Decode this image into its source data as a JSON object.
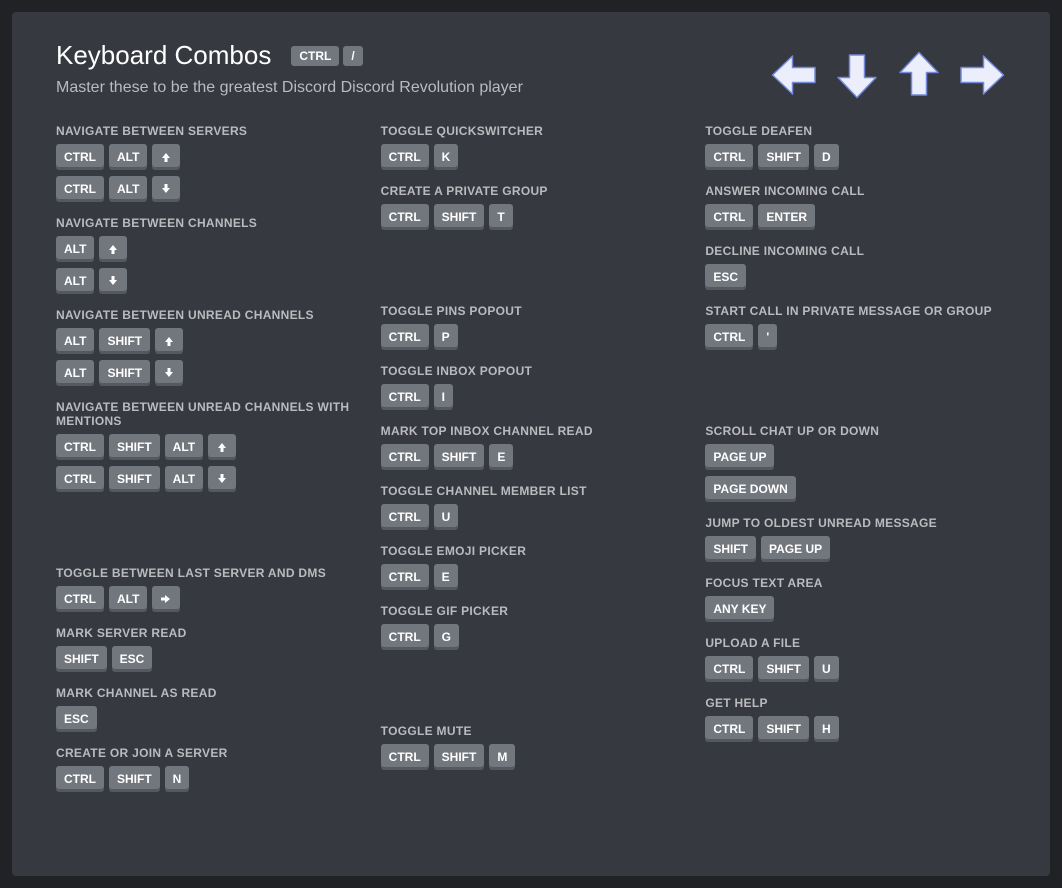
{
  "header": {
    "title": "Keyboard Combos",
    "subtitle": "Master these to be the greatest Discord Discord Revolution player",
    "keys": [
      "CTRL",
      "/"
    ]
  },
  "columns": [
    [
      {
        "title": "Navigate between servers",
        "combos": [
          [
            "CTRL",
            "ALT",
            "↑"
          ],
          [
            "CTRL",
            "ALT",
            "↓"
          ]
        ]
      },
      {
        "title": "Navigate between channels",
        "combos": [
          [
            "ALT",
            "↑"
          ],
          [
            "ALT",
            "↓"
          ]
        ]
      },
      {
        "title": "Navigate between unread channels",
        "combos": [
          [
            "ALT",
            "SHIFT",
            "↑"
          ],
          [
            "ALT",
            "SHIFT",
            "↓"
          ]
        ]
      },
      {
        "title": "Navigate between unread channels with mentions",
        "combos": [
          [
            "CTRL",
            "SHIFT",
            "ALT",
            "↑"
          ],
          [
            "CTRL",
            "SHIFT",
            "ALT",
            "↓"
          ]
        ]
      },
      {
        "gap": true
      },
      {
        "title": "Toggle between last server and DMs",
        "combos": [
          [
            "CTRL",
            "ALT",
            "→"
          ]
        ]
      },
      {
        "title": "Mark server read",
        "combos": [
          [
            "SHIFT",
            "ESC"
          ]
        ]
      },
      {
        "title": "Mark channel as read",
        "combos": [
          [
            "ESC"
          ]
        ]
      },
      {
        "title": "Create or join a server",
        "combos": [
          [
            "CTRL",
            "SHIFT",
            "N"
          ]
        ]
      }
    ],
    [
      {
        "title": "Toggle QuickSwitcher",
        "combos": [
          [
            "CTRL",
            "K"
          ]
        ]
      },
      {
        "title": "Create a private group",
        "combos": [
          [
            "CTRL",
            "SHIFT",
            "T"
          ]
        ]
      },
      {
        "gap": true
      },
      {
        "title": "Toggle pins popout",
        "combos": [
          [
            "CTRL",
            "P"
          ]
        ]
      },
      {
        "title": "Toggle inbox popout",
        "combos": [
          [
            "CTRL",
            "I"
          ]
        ]
      },
      {
        "title": "Mark top inbox channel read",
        "combos": [
          [
            "CTRL",
            "SHIFT",
            "E"
          ]
        ]
      },
      {
        "title": "Toggle channel member list",
        "combos": [
          [
            "CTRL",
            "U"
          ]
        ]
      },
      {
        "title": "Toggle emoji picker",
        "combos": [
          [
            "CTRL",
            "E"
          ]
        ]
      },
      {
        "title": "Toggle GIF picker",
        "combos": [
          [
            "CTRL",
            "G"
          ]
        ]
      },
      {
        "gap": true
      },
      {
        "title": "Toggle mute",
        "combos": [
          [
            "CTRL",
            "SHIFT",
            "M"
          ]
        ]
      }
    ],
    [
      {
        "title": "Toggle deafen",
        "combos": [
          [
            "CTRL",
            "SHIFT",
            "D"
          ]
        ]
      },
      {
        "title": "Answer incoming call",
        "combos": [
          [
            "CTRL",
            "ENTER"
          ]
        ]
      },
      {
        "title": "Decline incoming call",
        "combos": [
          [
            "ESC"
          ]
        ]
      },
      {
        "title": "Start call in private message or group",
        "combos": [
          [
            "CTRL",
            "'"
          ]
        ]
      },
      {
        "gap": true
      },
      {
        "title": "Scroll chat up or down",
        "combos": [
          [
            "PAGE UP"
          ],
          [
            "PAGE DOWN"
          ]
        ]
      },
      {
        "title": "Jump to oldest unread message",
        "combos": [
          [
            "SHIFT",
            "PAGE UP"
          ]
        ]
      },
      {
        "title": "Focus text area",
        "combos": [
          [
            "ANY KEY"
          ]
        ]
      },
      {
        "title": "Upload a file",
        "combos": [
          [
            "CTRL",
            "SHIFT",
            "U"
          ]
        ]
      },
      {
        "title": "Get help",
        "combos": [
          [
            "CTRL",
            "SHIFT",
            "H"
          ]
        ]
      }
    ]
  ]
}
